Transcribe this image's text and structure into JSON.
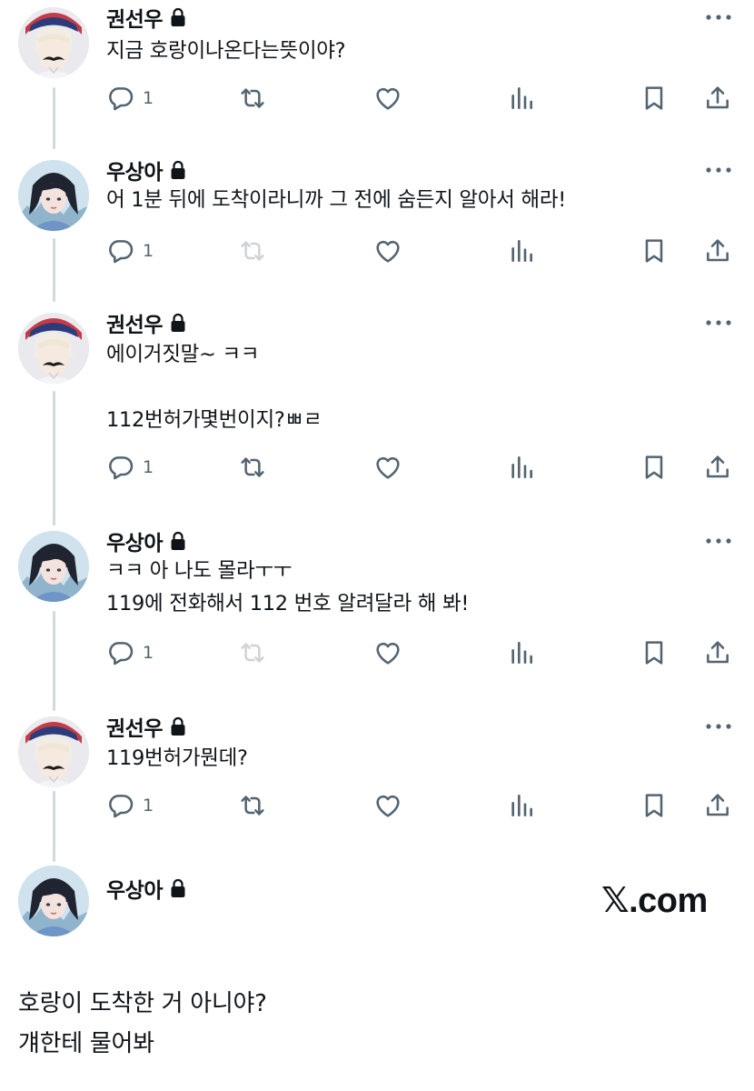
{
  "brand": {
    "watermark": "𝕏.com"
  },
  "colors": {
    "text": "#0f1419",
    "muted": "#536471",
    "thread_line": "#cfd9de"
  },
  "tweets": [
    {
      "author": "권선우",
      "avatar": "kwon",
      "text": "지금 호랑이나온다는뜻이야?",
      "reply_count": "1",
      "retweet_disabled": false
    },
    {
      "author": "우상아",
      "avatar": "woo",
      "text": "어 1분 뒤에 도착이라니까 그 전에 숨든지 알아서 해라!",
      "reply_count": "1",
      "retweet_disabled": true
    },
    {
      "author": "권선우",
      "avatar": "kwon",
      "text": "에이거짓말~ ㅋㅋ\n\n112번허가몇번이지?ㅃㄹ",
      "reply_count": "1",
      "retweet_disabled": false
    },
    {
      "author": "우상아",
      "avatar": "woo",
      "text": "ㅋㅋ 아 나도 몰라ㅜㅜ\n119에 전화해서 112 번호 알려달라 해 봐!",
      "reply_count": "1",
      "retweet_disabled": true
    },
    {
      "author": "권선우",
      "avatar": "kwon",
      "text": "119번허가뭔데?",
      "reply_count": "1",
      "retweet_disabled": false
    }
  ],
  "main_tweet": {
    "author": "우상아",
    "avatar": "woo",
    "text": "호랑이 도착한 거 아니야?\n걔한테 물어봐"
  },
  "icons": [
    "reply-icon",
    "retweet-icon",
    "like-icon",
    "views-icon",
    "bookmark-icon",
    "share-icon",
    "more-icon",
    "lock-icon"
  ]
}
